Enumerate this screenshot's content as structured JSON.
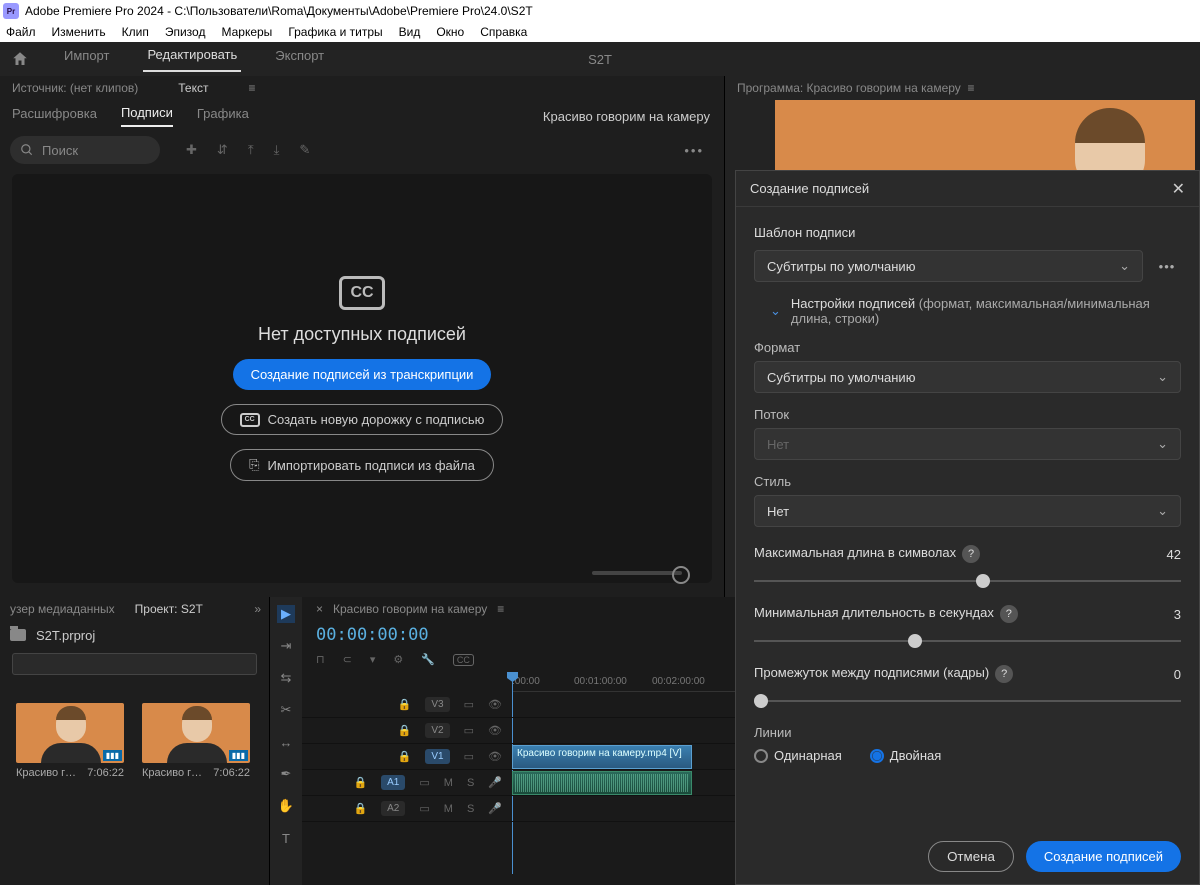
{
  "titlebar": {
    "app": "Adobe Premiere Pro 2024 - C:\\Пользователи\\Roma\\Документы\\Adobe\\Premiere Pro\\24.0\\S2T",
    "logo": "Pr"
  },
  "menubar": [
    "Файл",
    "Изменить",
    "Клип",
    "Эпизод",
    "Маркеры",
    "Графика и титры",
    "Вид",
    "Окно",
    "Справка"
  ],
  "workspace": {
    "tabs": [
      "Импорт",
      "Редактировать",
      "Экспорт"
    ],
    "active": 1,
    "project": "S2T"
  },
  "sourcepanel": {
    "source": "Источник: (нет клипов)",
    "text": "Текст"
  },
  "subtabs": {
    "items": [
      "Расшифровка",
      "Подписи",
      "Графика"
    ],
    "active": 1,
    "seqname": "Красиво говорим на камеру"
  },
  "search": {
    "placeholder": "Поиск"
  },
  "captions": {
    "empty": "Нет доступных подписей",
    "create": "Создание подписей из транскрипции",
    "newtrack": "Создать новую дорожку с подписью",
    "import": "Импортировать подписи из файла"
  },
  "program": {
    "title": "Программа: Красиво говорим на камеру"
  },
  "projectpanel": {
    "browser": "узер медиаданных",
    "project": "Проект: S2T",
    "filename": "S2T.prproj",
    "clips": [
      {
        "name": "Красиво гово...",
        "dur": "7:06:22"
      },
      {
        "name": "Красиво гово...",
        "dur": "7:06:22"
      }
    ]
  },
  "timeline": {
    "seq": "Красиво говорим на камеру",
    "timecode": "00:00:00:00",
    "ruler": [
      ":00:00",
      "00:01:00:00",
      "00:02:00:00"
    ],
    "vlabels": [
      "V3",
      "V2",
      "V1"
    ],
    "alabels": [
      "A1",
      "A2"
    ],
    "clipname": "Красиво говорим на камеру.mp4 [V]"
  },
  "dialog": {
    "title": "Создание подписей",
    "template_label": "Шаблон подписи",
    "template_value": "Субтитры по умолчанию",
    "settings_label": "Настройки подписей",
    "settings_hint": "(формат, максимальная/минимальная длина, строки)",
    "format_label": "Формат",
    "format_value": "Субтитры по умолчанию",
    "stream_label": "Поток",
    "stream_value": "Нет",
    "style_label": "Стиль",
    "style_value": "Нет",
    "maxlen_label": "Максимальная длина в символах",
    "maxlen_value": "42",
    "mindur_label": "Минимальная длительность в секундах",
    "mindur_value": "3",
    "gap_label": "Промежуток между подписями (кадры)",
    "gap_value": "0",
    "lines_label": "Линии",
    "radio_single": "Одинарная",
    "radio_double": "Двойная",
    "cancel": "Отмена",
    "submit": "Создание подписей"
  }
}
